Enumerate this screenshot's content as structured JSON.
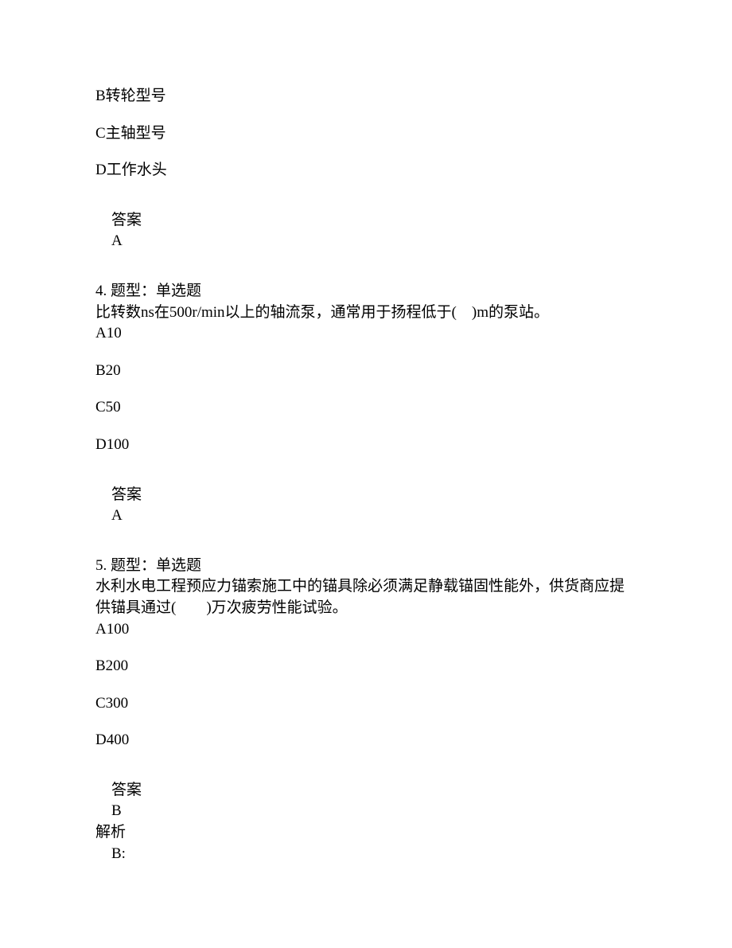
{
  "partial_options": {
    "optB": "B转轮型号",
    "optC": "C主轴型号",
    "optD": "D工作水头"
  },
  "answer3": {
    "label": "答案",
    "value": "A"
  },
  "question4": {
    "header": "4. 题型：单选题",
    "text": "比转数ns在500r/min以上的轴流泵，通常用于扬程低于(　)m的泵站。",
    "optA": "A10",
    "optB": "B20",
    "optC": "C50",
    "optD": "D100"
  },
  "answer4": {
    "label": "答案",
    "value": "A"
  },
  "question5": {
    "header": "5. 题型：单选题",
    "text": "水利水电工程预应力锚索施工中的锚具除必须满足静载锚固性能外，供货商应提供锚具通过(　　)万次疲劳性能试验。",
    "optA": "A100",
    "optB": "B200",
    "optC": "C300",
    "optD": "D400"
  },
  "answer5": {
    "label": "答案",
    "value": "B",
    "explain_label": "解析",
    "explain_value": "B:"
  }
}
